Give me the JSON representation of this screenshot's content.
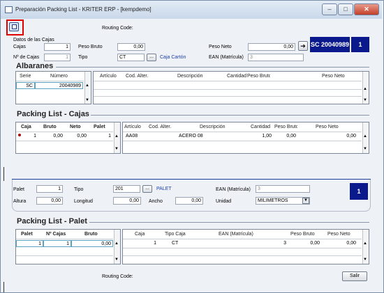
{
  "window": {
    "title": "Preparación Packing List - KRITER ERP - [kempdemo]",
    "minimize": "–",
    "maximize": "□",
    "close": "✕"
  },
  "header": {
    "routing_code_label": "Routing Code:",
    "datos_label": "Datos de las Cajas",
    "cajas_label": "Cajas",
    "cajas_value": "1",
    "peso_bruto_label": "Peso Bruto",
    "peso_bruto_value": "0,00",
    "peso_neto_label": "Peso Neto",
    "peso_neto_value": "0,00",
    "num_cajas_label": "Nº de Cajas",
    "num_cajas_value": "1",
    "tipo_label": "Tipo",
    "tipo_value": "CT",
    "tipo_desc": "Caja Cartón",
    "ean_label": "EAN (Matrícula)",
    "ean_value": "3",
    "sc_badge": "SC 20040989",
    "count_badge": "1",
    "browse": "..."
  },
  "albaranes": {
    "title": "Albaranes",
    "left_headers": [
      "Serie",
      "Número"
    ],
    "left_rows": [
      [
        "SC",
        "20040989"
      ]
    ],
    "right_headers": [
      "Artículo",
      "Cod. Alter.",
      "Descripción",
      "Cantidad",
      "Peso Bruto",
      "Peso Neto"
    ]
  },
  "cajas": {
    "title": "Packing List - Cajas",
    "left_headers": [
      "Caja",
      "Bruto",
      "Neto",
      "Palet"
    ],
    "left_rows": [
      [
        "1",
        "0,00",
        "0,00",
        "1"
      ]
    ],
    "right_headers": [
      "Artículo",
      "Cod. Alter.",
      "Descripción",
      "Cantidad",
      "Peso Bruto",
      "Peso Neto"
    ],
    "right_rows": [
      [
        "AA08",
        "",
        "ACERO 08",
        "1,00",
        "0,00",
        "0,00"
      ]
    ]
  },
  "palet_form": {
    "palet_label": "Palet",
    "palet_value": "1",
    "tipo_label": "Tipo",
    "tipo_value": "201",
    "tipo_desc": "PALET",
    "ean_label": "EAN (Matrícula)",
    "ean_value": "3",
    "altura_label": "Altura",
    "altura_value": "0,00",
    "longitud_label": "Longitud",
    "longitud_value": "0,00",
    "ancho_label": "Ancho",
    "ancho_value": "0,00",
    "unidad_label": "Unidad",
    "unidad_value": "MILIMETROS",
    "count_badge": "1",
    "browse": "..."
  },
  "palet": {
    "title": "Packing List - Palet",
    "left_headers": [
      "Palet",
      "Nº Cajas",
      "Bruto"
    ],
    "left_rows": [
      [
        "1",
        "1",
        "0,00"
      ]
    ],
    "right_headers": [
      "Caja",
      "Tipo Caja",
      "EAN (Matrícula)",
      "Peso Bruto",
      "Peso Neto"
    ],
    "right_rows": [
      [
        "1",
        "CT",
        "3",
        "0,00",
        "0,00"
      ]
    ]
  },
  "footer": {
    "routing_code_label": "Routing Code:",
    "salir_label": "Salir"
  },
  "colors": {
    "badge_blue": "#0a1a8c",
    "link_blue": "#1d3fa8",
    "highlight_red": "#e00000"
  },
  "icons": {
    "app": "window-icon",
    "toolbar": "pages-icon",
    "arrow": "arrow-right-icon"
  }
}
